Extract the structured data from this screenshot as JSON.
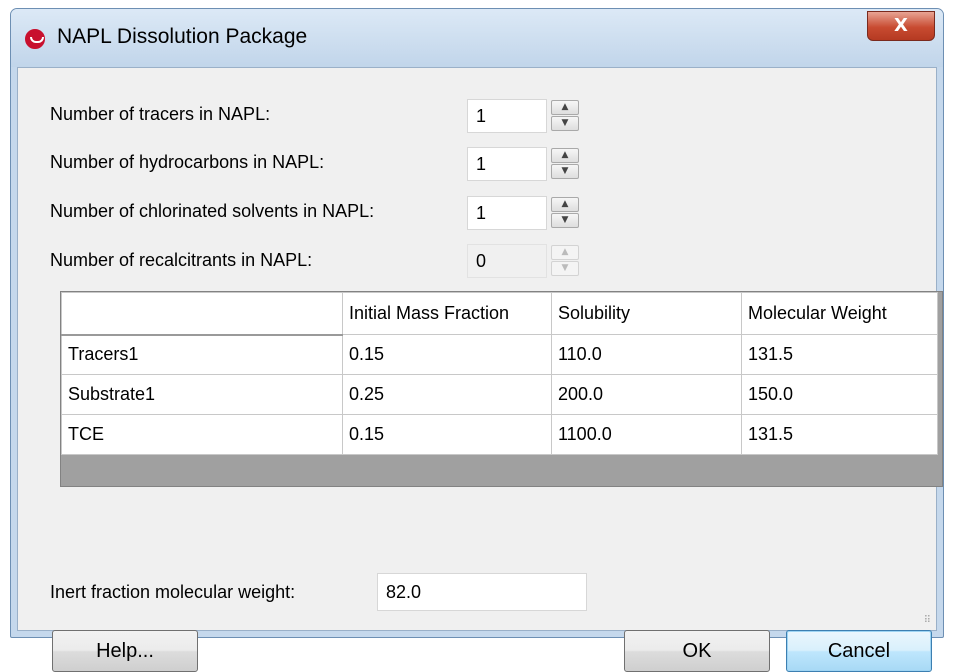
{
  "window": {
    "title": "NAPL Dissolution Package",
    "close_label": "X"
  },
  "fields": [
    {
      "label": "Number of tracers in NAPL:",
      "value": "1",
      "enabled": true
    },
    {
      "label": "Number of hydrocarbons in NAPL:",
      "value": "1",
      "enabled": true
    },
    {
      "label": "Number of chlorinated solvents in NAPL:",
      "value": "1",
      "enabled": true
    },
    {
      "label": "Number of recalcitrants in NAPL:",
      "value": "0",
      "enabled": false
    }
  ],
  "table": {
    "columns": [
      "",
      "Initial Mass Fraction",
      "Solubility",
      "Molecular Weight"
    ],
    "rows": [
      [
        "Tracers1",
        "0.15",
        "110.0",
        "131.5"
      ],
      [
        "Substrate1",
        "0.25",
        "200.0",
        "150.0"
      ],
      [
        "TCE",
        "0.15",
        "1100.0",
        "131.5"
      ]
    ]
  },
  "inert": {
    "label": "Inert fraction molecular weight:",
    "value": "82.0"
  },
  "buttons": {
    "help": "Help...",
    "ok": "OK",
    "cancel": "Cancel"
  },
  "icons": {
    "app": "napl-app-icon",
    "spin_up": "spin-up-arrow-icon",
    "spin_down": "spin-down-arrow-icon"
  }
}
